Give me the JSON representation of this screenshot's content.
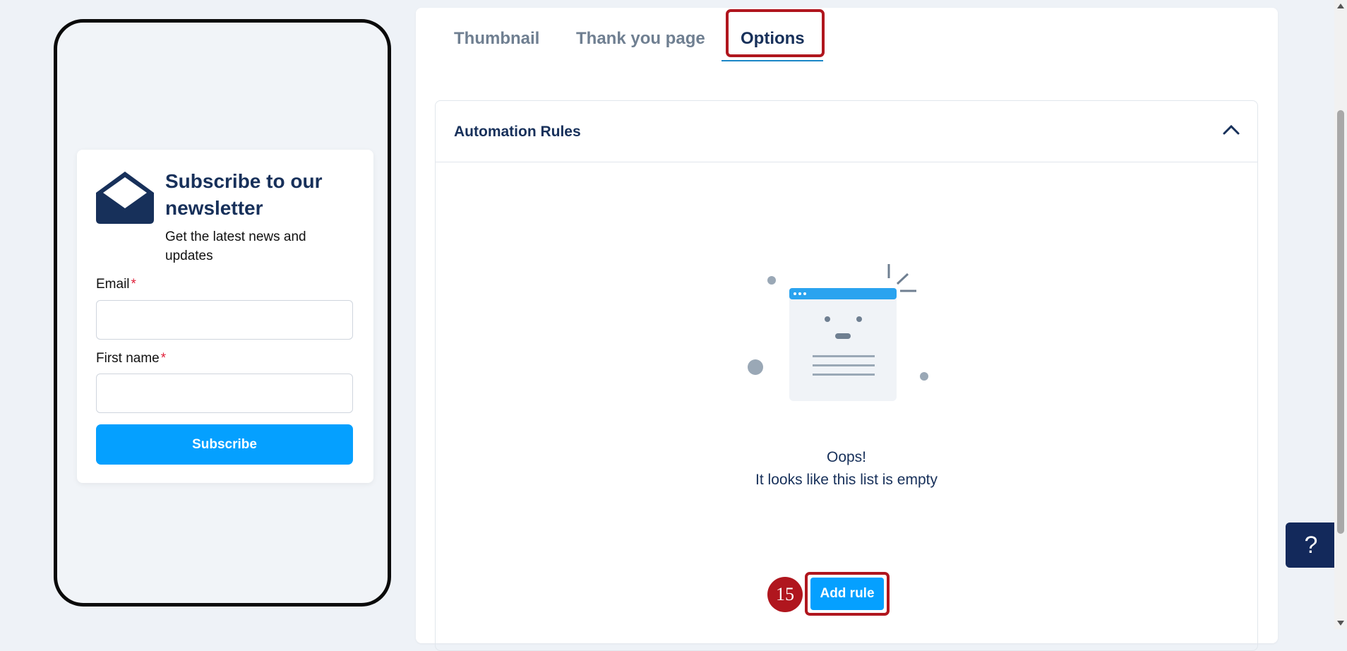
{
  "preview": {
    "title": "Subscribe to our newsletter",
    "subtitle": "Get the latest news and updates",
    "email_label": "Email",
    "first_name_label": "First name",
    "required_mark": "*",
    "subscribe_label": "Subscribe"
  },
  "tabs": [
    {
      "label": "Thumbnail",
      "active": false
    },
    {
      "label": "Thank you page",
      "active": false
    },
    {
      "label": "Options",
      "active": true
    }
  ],
  "rules": {
    "title": "Automation Rules",
    "empty_title": "Oops!",
    "empty_message": "It looks like this list is empty",
    "add_rule_label": "Add rule"
  },
  "step_badge": "15",
  "help": {
    "label": "?"
  },
  "colors": {
    "accent": "#05a0ff",
    "navy": "#17305a",
    "highlight": "#b0161e",
    "required": "#e0213b"
  }
}
